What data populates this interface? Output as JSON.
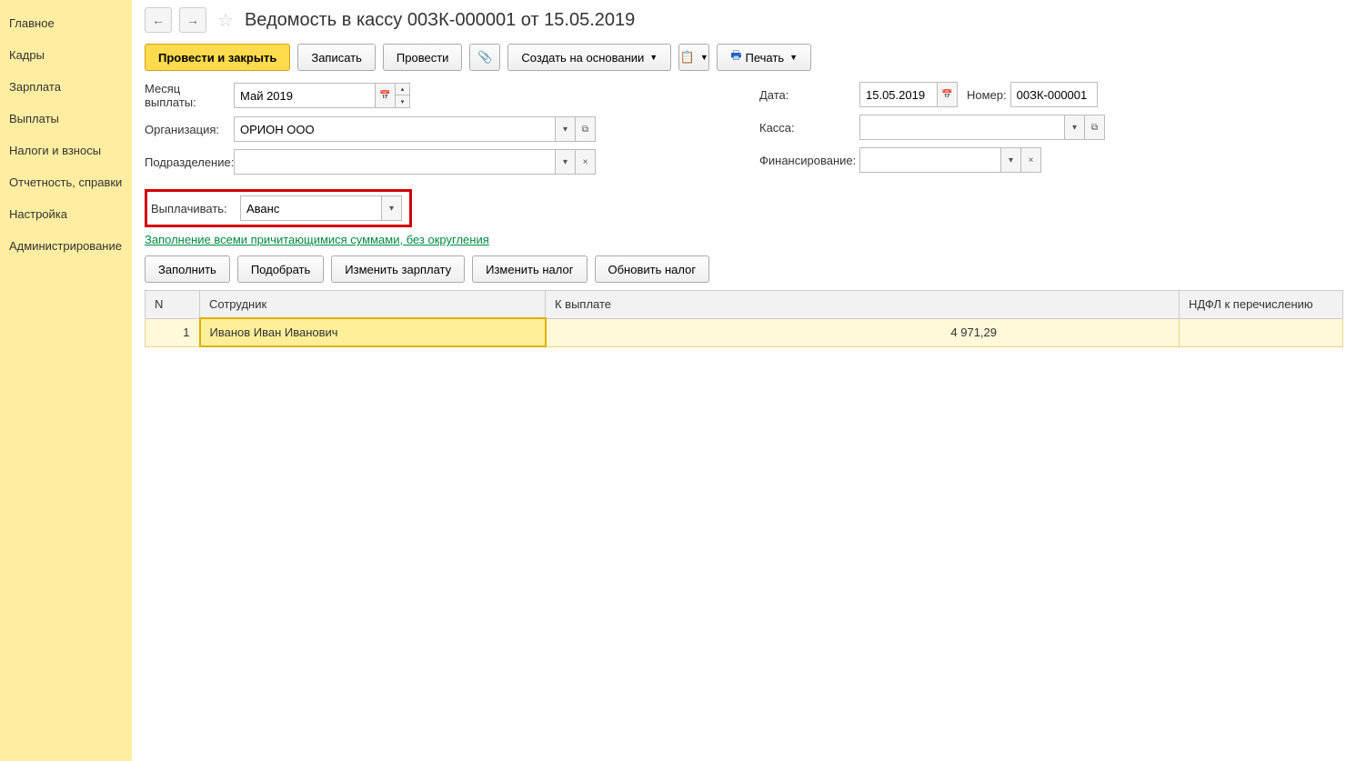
{
  "sidebar": {
    "items": [
      "Главное",
      "Кадры",
      "Зарплата",
      "Выплаты",
      "Налоги и взносы",
      "Отчетность, справки",
      "Настройка",
      "Администрирование"
    ]
  },
  "header": {
    "title": "Ведомость в кассу 00ЗК-000001 от 15.05.2019"
  },
  "toolbar": {
    "post_close": "Провести и закрыть",
    "save": "Записать",
    "post": "Провести",
    "create_based": "Создать на основании",
    "print": "Печать"
  },
  "form": {
    "month_label": "Месяц выплаты:",
    "month_value": "Май 2019",
    "org_label": "Организация:",
    "org_value": "ОРИОН ООО",
    "dept_label": "Подразделение:",
    "dept_value": "",
    "pay_label": "Выплачивать:",
    "pay_value": "Аванс",
    "date_label": "Дата:",
    "date_value": "15.05.2019",
    "number_label": "Номер:",
    "number_value": "00ЗК-000001",
    "kassa_label": "Касса:",
    "kassa_value": "",
    "fin_label": "Финансирование:",
    "fin_value": ""
  },
  "link": "Заполнение всеми причитающимися суммами, без округления",
  "table_toolbar": {
    "fill": "Заполнить",
    "pick": "Подобрать",
    "change_salary": "Изменить зарплату",
    "change_tax": "Изменить налог",
    "update_tax": "Обновить налог"
  },
  "table": {
    "headers": {
      "n": "N",
      "employee": "Сотрудник",
      "pay": "К выплате",
      "ndfl": "НДФЛ к перечислению"
    },
    "rows": [
      {
        "n": "1",
        "employee": "Иванов Иван Иванович",
        "pay": "4 971,29",
        "ndfl": ""
      }
    ]
  }
}
